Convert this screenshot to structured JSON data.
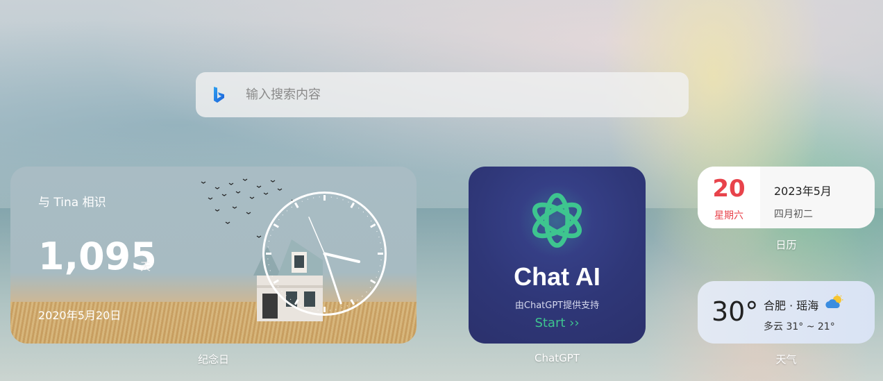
{
  "search": {
    "engine_icon": "bing-icon",
    "placeholder": "输入搜索内容"
  },
  "anniversary": {
    "title": "与 Tina 相识",
    "count": "1,095",
    "unit": "天",
    "date": "2020年5月20日",
    "caption": "纪念日"
  },
  "chatgpt": {
    "name": "Chat AI",
    "subtitle": "由ChatGPT提供支持",
    "start": "Start ››",
    "caption": "ChatGPT",
    "accent": "#3ec58f"
  },
  "calendar": {
    "day": "20",
    "weekday": "星期六",
    "year_month": "2023年5月",
    "lunar": "四月初二",
    "caption": "日历",
    "accent": "#e8434b"
  },
  "weather": {
    "temperature": "30°",
    "location": "合肥 · 瑶海",
    "condition": "多云 31° ~ 21°",
    "icon": "partly-cloudy-icon",
    "caption": "天气"
  }
}
